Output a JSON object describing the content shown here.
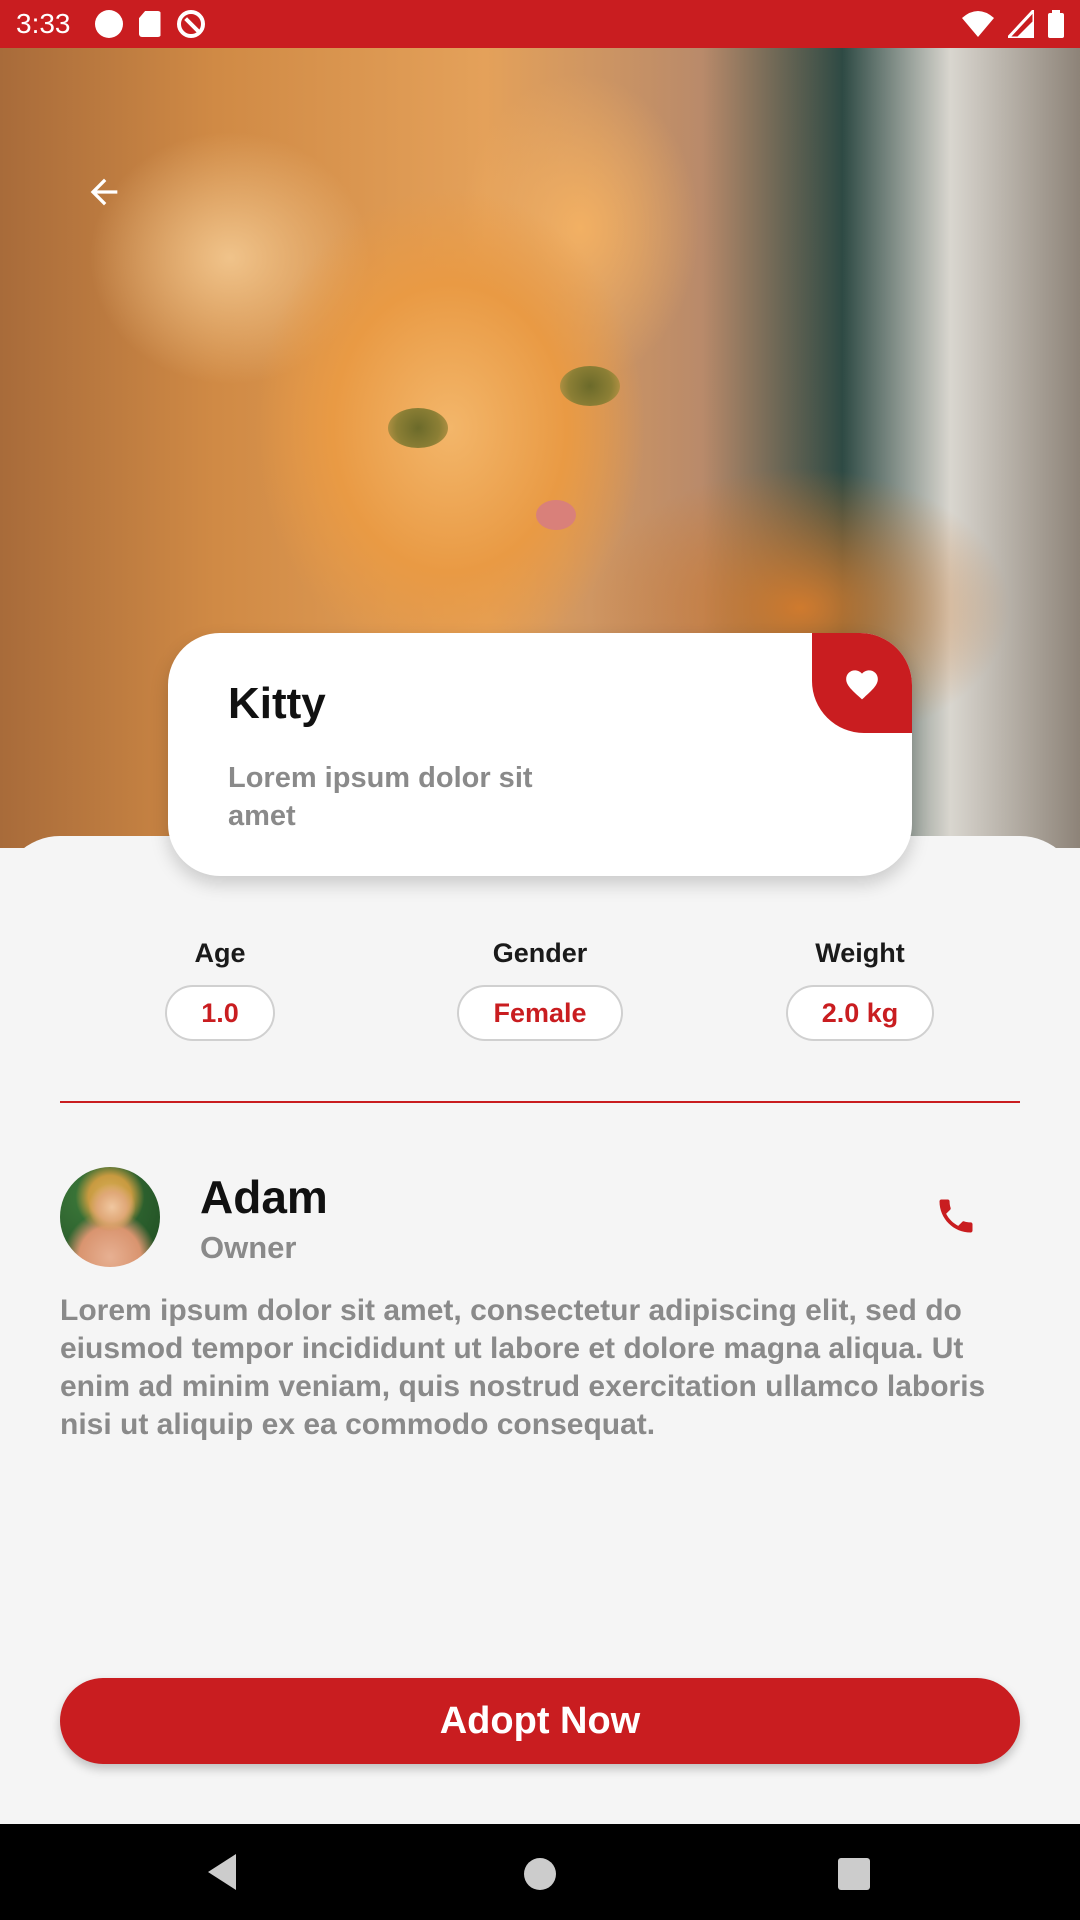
{
  "status_bar": {
    "time": "3:33",
    "left_icons": [
      "circle-icon",
      "sd-card-icon",
      "data-saver-icon"
    ],
    "right_icons": [
      "wifi-icon",
      "signal-icon",
      "battery-icon"
    ]
  },
  "hero": {
    "icon": "back-arrow-icon"
  },
  "pet": {
    "name": "Kitty",
    "subtitle": "Lorem ipsum dolor sit amet",
    "favorite_icon": "heart-icon"
  },
  "stats": {
    "age": {
      "label": "Age",
      "value": "1.0"
    },
    "gender": {
      "label": "Gender",
      "value": "Female"
    },
    "weight": {
      "label": "Weight",
      "value": "2.0 kg"
    }
  },
  "owner": {
    "name": "Adam",
    "role": "Owner",
    "call_icon": "phone-icon"
  },
  "description": "Lorem ipsum dolor sit amet, consectetur adipiscing elit, sed do eiusmod tempor incididunt ut labore et dolore magna aliqua. Ut enim ad minim veniam, quis nostrud exercitation ullamco laboris nisi ut aliquip ex ea commodo consequat.",
  "actions": {
    "adopt_label": "Adopt Now"
  },
  "colors": {
    "accent": "#c91d20",
    "background": "#f5f5f5",
    "muted_text": "#8a8a8a"
  }
}
